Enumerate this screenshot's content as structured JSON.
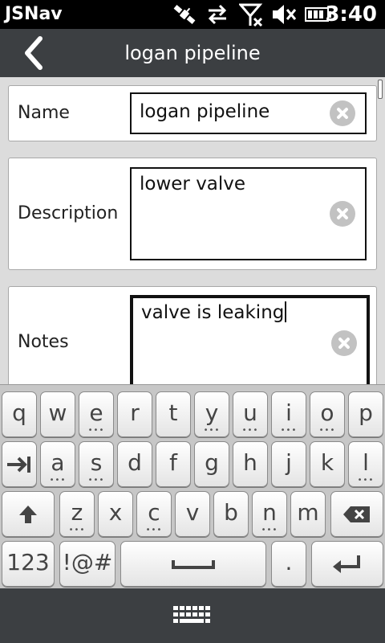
{
  "status_bar": {
    "app_name": "JSNav",
    "time": "3:40",
    "icons": [
      "gps-satellite-icon",
      "data-transfer-icon",
      "no-signal-icon",
      "speaker-muted-icon",
      "battery-icon"
    ]
  },
  "header": {
    "title": "logan pipeline",
    "back_icon": "chevron-left-icon"
  },
  "form": {
    "name_label": "Name",
    "name_value": "logan pipeline",
    "description_label": "Description",
    "description_value": "lower valve",
    "notes_label": "Notes",
    "notes_value": "valve is leaking"
  },
  "keyboard": {
    "row1": [
      "q",
      "w",
      "e",
      "r",
      "t",
      "y",
      "u",
      "i",
      "o",
      "p"
    ],
    "row2": [
      "a",
      "s",
      "d",
      "f",
      "g",
      "h",
      "j",
      "k",
      "l"
    ],
    "row3": [
      "z",
      "x",
      "c",
      "v",
      "b",
      "n",
      "m"
    ],
    "numbers_label": "123",
    "symbols_label": "!@#",
    "period_label": "."
  },
  "colors": {
    "bar": "#3c3f42",
    "background": "#dcdcdc"
  }
}
